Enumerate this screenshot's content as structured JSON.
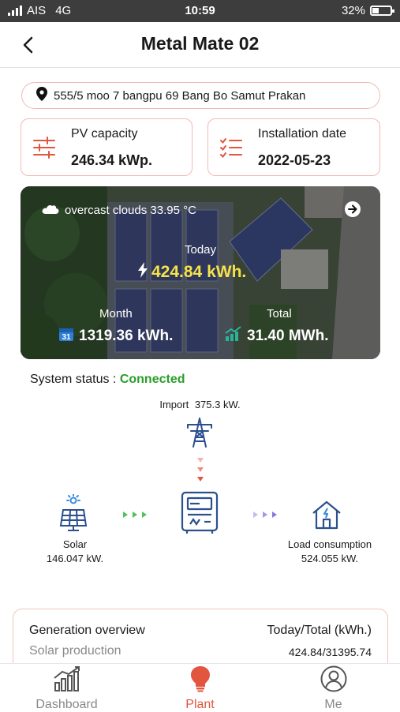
{
  "status_bar": {
    "carrier": "AIS",
    "network": "4G",
    "time": "10:59",
    "battery": "32%"
  },
  "header": {
    "title": "Metal Mate 02",
    "back_icon": "chevron-left-icon"
  },
  "address": {
    "text": "555/5 moo 7 bangpu 69  Bang Bo  Samut Prakan"
  },
  "pv_capacity": {
    "label": "PV capacity",
    "value": "246.34 kWp."
  },
  "installation": {
    "label": "Installation date",
    "value": "2022-05-23"
  },
  "hero": {
    "weather": "overcast clouds  33.95 °C",
    "today_label": "Today",
    "today_value": "424.84 kWh.",
    "month_label": "Month",
    "month_value": "1319.36 kWh.",
    "calendar_day": "31",
    "total_label": "Total",
    "total_value": "31.40 MWh."
  },
  "system": {
    "label": "System status :",
    "status": "Connected",
    "status_color": "#2a9d2a"
  },
  "flow": {
    "import_label": "Import",
    "import_value": "375.3 kW.",
    "solar_label": "Solar",
    "solar_value": "146.047 kW.",
    "load_label": "Load consumption",
    "load_value": "524.055 kW."
  },
  "overview": {
    "title": "Generation overview",
    "column": "Today/Total (kWh.)",
    "row_label": "Solar production",
    "row_value": "424.84/31395.74"
  },
  "tabs": [
    {
      "label": "Dashboard",
      "icon": "bar-chart-icon",
      "active": false
    },
    {
      "label": "Plant",
      "icon": "lightbulb-icon",
      "active": true
    },
    {
      "label": "Me",
      "icon": "user-icon",
      "active": false
    }
  ],
  "colors": {
    "accent": "#e2553f",
    "card_border": "#f0b9b5",
    "today_value": "#f6e34a"
  }
}
